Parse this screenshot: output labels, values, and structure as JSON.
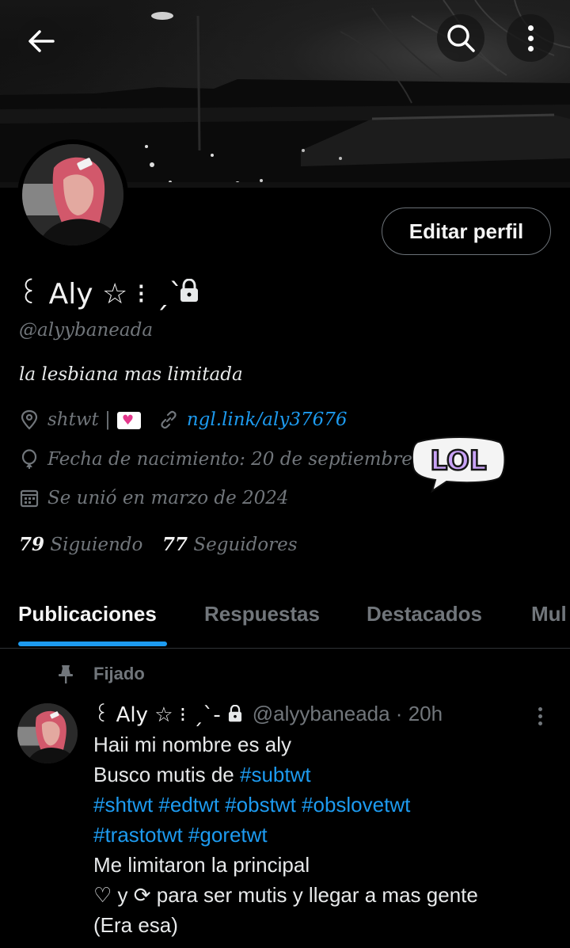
{
  "header": {
    "back_icon": "arrow-left-icon",
    "search_icon": "search-icon",
    "more_icon": "more-vertical-icon"
  },
  "profile": {
    "display_name": "꒰ Aly ☆ ⁝ ˏˋ-",
    "protected_icon": "lock-icon",
    "handle": "@alyybaneada",
    "bio": "la lesbiana mas limitada",
    "edit_button": "Editar perfil",
    "location": "shtwt |",
    "location_emoji": "heart-letter-emoji",
    "link": "ngl.link/aly37676",
    "birthday": "Fecha de nacimiento: 20 de septiembre",
    "joined": "Se unió en marzo de 2024",
    "following_count": "79",
    "following_label": "Siguiendo",
    "followers_count": "77",
    "followers_label": "Seguidores",
    "sticker_text": "LOL"
  },
  "tabs": [
    {
      "label": "Publicaciones",
      "active": true
    },
    {
      "label": "Respuestas",
      "active": false
    },
    {
      "label": "Destacados",
      "active": false
    },
    {
      "label": "Mul",
      "active": false
    }
  ],
  "post": {
    "pinned_label": "Fijado",
    "author_name": "꒰ Aly ☆ ⁝ ˏˋ-",
    "author_handle": "@alyybaneada · 20h",
    "lines": [
      {
        "text": "Haii mi nombre es aly"
      },
      {
        "text": "Busco mutis de ",
        "tag": "#subtwt"
      },
      {
        "tag": "#shtwt #edtwt #obstwt #obslovetwt"
      },
      {
        "tag": "#trastotwt #goretwt"
      },
      {
        "text": "Me limitaron la principal"
      },
      {
        "text": "♡ y ⟳ para ser mutis y llegar a mas gente"
      },
      {
        "text": "(Era esa)"
      }
    ]
  },
  "colors": {
    "background": "#000000",
    "accent": "#1d9bf0",
    "muted": "#71767b",
    "text": "#e7e9ea"
  }
}
